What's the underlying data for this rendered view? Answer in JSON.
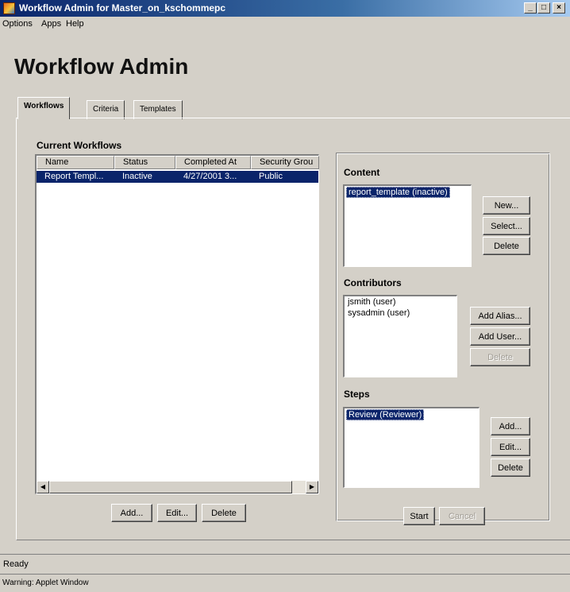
{
  "window": {
    "title": "Workflow Admin for Master_on_kschommepc",
    "controls": {
      "minimize": "_",
      "maximize": "□",
      "close": "×"
    }
  },
  "menu": [
    "Options",
    "Apps",
    "Help"
  ],
  "page_title": "Workflow Admin",
  "tabs": [
    {
      "label": "Workflows",
      "active": true
    },
    {
      "label": "Criteria",
      "active": false
    },
    {
      "label": "Templates",
      "active": false
    }
  ],
  "workflows": {
    "heading": "Current Workflows",
    "columns": [
      "Name",
      "Status",
      "Completed At",
      "Security Grou"
    ],
    "rows": [
      {
        "name": "Report Templ...",
        "status": "Inactive",
        "completed_at": "4/27/2001 3...",
        "security_group": "Public",
        "selected": true
      }
    ],
    "buttons": {
      "add": "Add...",
      "edit": "Edit...",
      "delete": "Delete"
    }
  },
  "content": {
    "heading": "Content",
    "items": [
      {
        "label": "report_template (inactive)",
        "selected": true
      }
    ],
    "buttons": {
      "new": "New...",
      "select": "Select...",
      "delete": "Delete"
    }
  },
  "contributors": {
    "heading": "Contributors",
    "items": [
      {
        "label": "jsmith (user)"
      },
      {
        "label": "sysadmin (user)"
      }
    ],
    "buttons": {
      "add_alias": "Add Alias...",
      "add_user": "Add User...",
      "delete": "Delete"
    }
  },
  "steps": {
    "heading": "Steps",
    "items": [
      {
        "label": "Review (Reviewer)",
        "selected": true
      }
    ],
    "buttons": {
      "add": "Add...",
      "edit": "Edit...",
      "delete": "Delete"
    }
  },
  "actions": {
    "start": "Start",
    "cancel": "Cancel"
  },
  "status": "Ready",
  "applet_warning": "Warning: Applet Window",
  "colors": {
    "selection": "#0a246a",
    "face": "#d4d0c8"
  },
  "icons": {
    "app": "workflow-app-icon",
    "scroll_left": "arrow-left-icon",
    "scroll_right": "arrow-right-icon"
  }
}
